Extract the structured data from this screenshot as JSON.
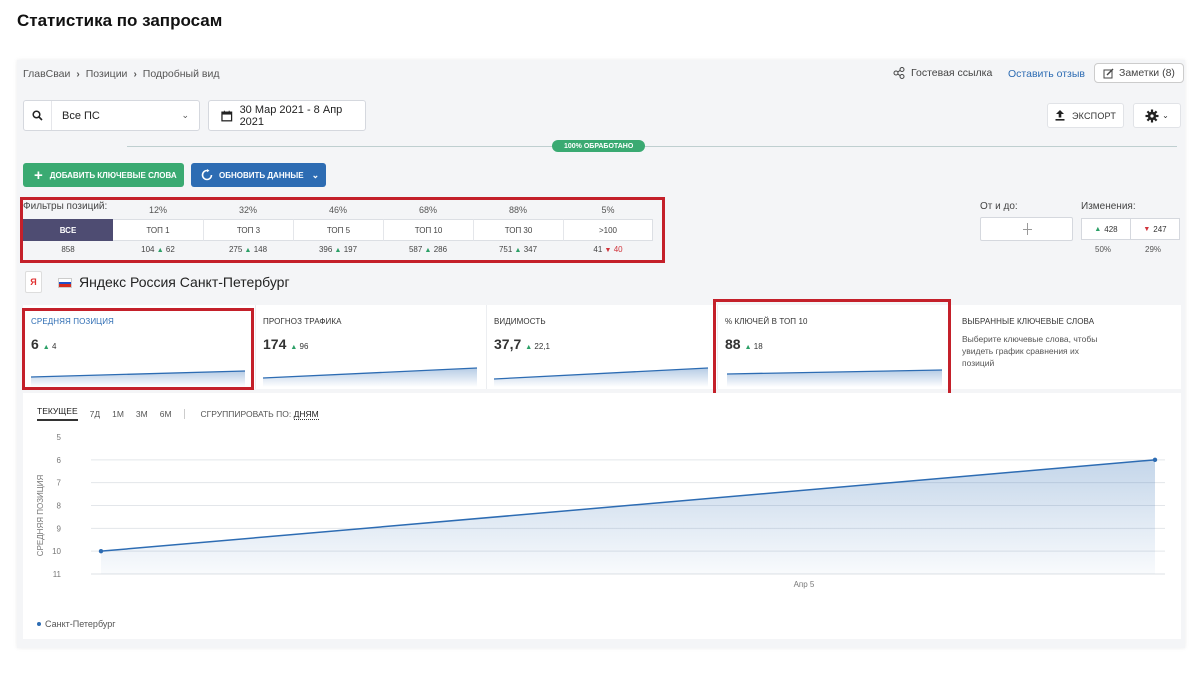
{
  "page_heading": "Статистика по запросам",
  "breadcrumb": [
    "ГлавСваи",
    "Позиции",
    "Подробный вид"
  ],
  "topbar": {
    "guest_link": "Гостевая ссылка",
    "feedback": "Оставить отзыв",
    "notes": "Заметки (8)"
  },
  "ps_select": {
    "value": "Все ПС"
  },
  "date_range": "30 Мар 2021 - 8 Апр 2021",
  "export_label": "ЭКСПОРТ",
  "processed_badge": "100% ОБРАБОТАНО",
  "buttons": {
    "add_keywords": "ДОБАВИТЬ КЛЮЧЕВЫЕ СЛОВА",
    "update_data": "ОБНОВИТЬ ДАННЫЕ"
  },
  "filters": {
    "label": "Фильтры позиций:",
    "columns": [
      {
        "pct": "",
        "tab": "ВСЕ",
        "count": "858",
        "delta": "",
        "dir": ""
      },
      {
        "pct": "12%",
        "tab": "ТОП 1",
        "count": "104",
        "delta": "62",
        "dir": "up"
      },
      {
        "pct": "32%",
        "tab": "ТОП 3",
        "count": "275",
        "delta": "148",
        "dir": "up"
      },
      {
        "pct": "46%",
        "tab": "ТОП 5",
        "count": "396",
        "delta": "197",
        "dir": "up"
      },
      {
        "pct": "68%",
        "tab": "ТОП 10",
        "count": "587",
        "delta": "286",
        "dir": "up"
      },
      {
        "pct": "88%",
        "tab": "ТОП 30",
        "count": "751",
        "delta": "347",
        "dir": "up"
      },
      {
        "pct": "5%",
        "tab": ">100",
        "count": "41",
        "delta": "40",
        "dir": "down"
      }
    ]
  },
  "range": {
    "label": "От и до:"
  },
  "changes": {
    "label": "Изменения:",
    "up": "428",
    "down": "247",
    "up_pct": "50%",
    "down_pct": "29%"
  },
  "region": {
    "title": "Яндекс Россия Санкт-Петербург",
    "logo_letter": "Я"
  },
  "cards": [
    {
      "label": "СРЕДНЯЯ ПОЗИЦИЯ",
      "value": "6",
      "delta": "4"
    },
    {
      "label": "ПРОГНОЗ ТРАФИКА",
      "value": "174",
      "delta": "96"
    },
    {
      "label": "ВИДИМОСТЬ",
      "value": "37,7",
      "delta": "22,1"
    },
    {
      "label": "% КЛЮЧЕЙ В ТОП 10",
      "value": "88",
      "delta": "18"
    },
    {
      "label": "ВЫБРАННЫЕ КЛЮЧЕВЫЕ СЛОВА",
      "description": "Выберите ключевые слова, чтобы увидеть график сравнения их позиций"
    }
  ],
  "chart_tabs": [
    "ТЕКУЩЕЕ",
    "7Д",
    "1М",
    "3М",
    "6М"
  ],
  "group_by": {
    "label": "СГРУППИРОВАТЬ ПО:",
    "value": "ДНЯМ"
  },
  "colors": {
    "accent": "#2d6cb3",
    "green": "#3aaa72",
    "highlight": "#c4202a",
    "active_tab": "#4e4c72"
  },
  "chart_data": {
    "type": "area",
    "ylabel": "СРЕДНЯЯ ПОЗИЦИЯ",
    "yticks": [
      "5",
      "6",
      "7",
      "8",
      "9",
      "10",
      "11"
    ],
    "ylim": [
      5,
      11
    ],
    "y_inverted": true,
    "xticks": [
      "Апр 5"
    ],
    "series": [
      {
        "name": "Санкт-Петербург",
        "x": [
          "Мар 30",
          "Апр 8"
        ],
        "values": [
          10,
          6
        ]
      }
    ],
    "grid": true
  }
}
